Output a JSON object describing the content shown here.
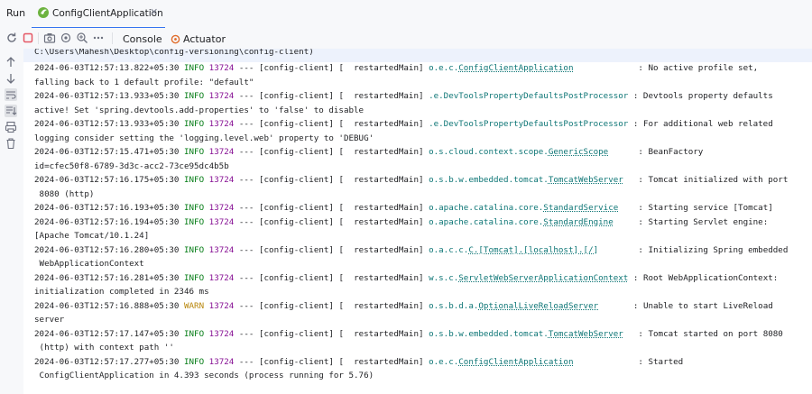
{
  "tabbar": {
    "run_label": "Run",
    "tab_label": "ConfigClientApplication"
  },
  "toolbar": {
    "console_label": "Console",
    "actuator_label": "Actuator",
    "icons": [
      "rerun-icon",
      "stop-icon",
      "camera-icon",
      "settings-icon",
      "profiler-icon"
    ]
  },
  "sidebar": {
    "icons": [
      "scroll-up-icon",
      "scroll-down-icon",
      "soft-wrap-icon",
      "scroll-to-end-icon",
      "print-icon",
      "trash-icon"
    ]
  },
  "console": {
    "path_line": "C:\\Users\\Mahesh\\Desktop\\config-versioning\\config-client)",
    "entries": [
      {
        "ts": "2024-06-03T12:57:13.822+05:30",
        "level": "INFO",
        "pid": "13724",
        "mid": " --- [config-client] [  restartedMain] ",
        "pre": "o.e.c.",
        "cls": "ConfigClientApplication",
        "pad": "            ",
        "msg": " : No active profile set,",
        "cont": "falling back to 1 default profile: \"default\""
      },
      {
        "ts": "2024-06-03T12:57:13.933+05:30",
        "level": "INFO",
        "pid": "13724",
        "mid": " --- [config-client] [  restartedMain] ",
        "pre": ".e.DevToolsPropertyDefaultsPostProcessor",
        "cls": "",
        "pad": "",
        "msg": " : Devtools property defaults",
        "cont": "active! Set 'spring.devtools.add-properties' to 'false' to disable"
      },
      {
        "ts": "2024-06-03T12:57:13.933+05:30",
        "level": "INFO",
        "pid": "13724",
        "mid": " --- [config-client] [  restartedMain] ",
        "pre": ".e.DevToolsPropertyDefaultsPostProcessor",
        "cls": "",
        "pad": "",
        "msg": " : For additional web related",
        "cont": "logging consider setting the 'logging.level.web' property to 'DEBUG'"
      },
      {
        "ts": "2024-06-03T12:57:15.471+05:30",
        "level": "INFO",
        "pid": "13724",
        "mid": " --- [config-client] [  restartedMain] ",
        "pre": "o.s.cloud.context.scope.",
        "cls": "GenericScope",
        "pad": "     ",
        "msg": " : BeanFactory",
        "cont": "id=cfec50f8-6789-3d3c-acc2-73ce95dc4b5b"
      },
      {
        "ts": "2024-06-03T12:57:16.175+05:30",
        "level": "INFO",
        "pid": "13724",
        "mid": " --- [config-client] [  restartedMain] ",
        "pre": "o.s.b.w.embedded.tomcat.",
        "cls": "TomcatWebServer",
        "pad": "  ",
        "msg": " : Tomcat initialized with port",
        "cont": " 8080 (http)"
      },
      {
        "ts": "2024-06-03T12:57:16.193+05:30",
        "level": "INFO",
        "pid": "13724",
        "mid": " --- [config-client] [  restartedMain] ",
        "pre": "o.apache.catalina.core.",
        "cls": "StandardService",
        "pad": "   ",
        "msg": " : Starting service [Tomcat]",
        "cont": ""
      },
      {
        "ts": "2024-06-03T12:57:16.194+05:30",
        "level": "INFO",
        "pid": "13724",
        "mid": " --- [config-client] [  restartedMain] ",
        "pre": "o.apache.catalina.core.",
        "cls": "StandardEngine",
        "pad": "    ",
        "msg": " : Starting Servlet engine:",
        "cont": "[Apache Tomcat/10.1.24]"
      },
      {
        "ts": "2024-06-03T12:57:16.280+05:30",
        "level": "INFO",
        "pid": "13724",
        "mid": " --- [config-client] [  restartedMain] ",
        "pre": "o.a.c.c.",
        "cls": "C.[Tomcat].[localhost].[/]",
        "pad": "       ",
        "msg": " : Initializing Spring embedded",
        "cont": " WebApplicationContext"
      },
      {
        "ts": "2024-06-03T12:57:16.281+05:30",
        "level": "INFO",
        "pid": "13724",
        "mid": " --- [config-client] [  restartedMain] ",
        "pre": "w.s.c.",
        "cls": "ServletWebServerApplicationContext",
        "pad": "",
        "msg": " : Root WebApplicationContext:",
        "cont": "initialization completed in 2346 ms"
      },
      {
        "ts": "2024-06-03T12:57:16.888+05:30",
        "level": "WARN",
        "pid": "13724",
        "mid": " --- [config-client] [  restartedMain] ",
        "pre": "o.s.b.d.a.",
        "cls": "OptionalLiveReloadServer",
        "pad": "      ",
        "msg": " : Unable to start LiveReload",
        "cont": "server"
      },
      {
        "ts": "2024-06-03T12:57:17.147+05:30",
        "level": "INFO",
        "pid": "13724",
        "mid": " --- [config-client] [  restartedMain] ",
        "pre": "o.s.b.w.embedded.tomcat.",
        "cls": "TomcatWebServer",
        "pad": "  ",
        "msg": " : Tomcat started on port 8080",
        "cont": " (http) with context path ''"
      },
      {
        "ts": "2024-06-03T12:57:17.277+05:30",
        "level": "INFO",
        "pid": "13724",
        "mid": " --- [config-client] [  restartedMain] ",
        "pre": "o.e.c.",
        "cls": "ConfigClientApplication",
        "pad": "            ",
        "msg": " : Started",
        "cont": " ConfigClientApplication in 4.393 seconds (process running for 5.76)"
      }
    ]
  },
  "colors": {
    "accent": "#3574f0",
    "info": "#067d17",
    "warn": "#b8860b",
    "pid": "#871094",
    "logger": "#0e7676",
    "stop": "#e55765"
  }
}
